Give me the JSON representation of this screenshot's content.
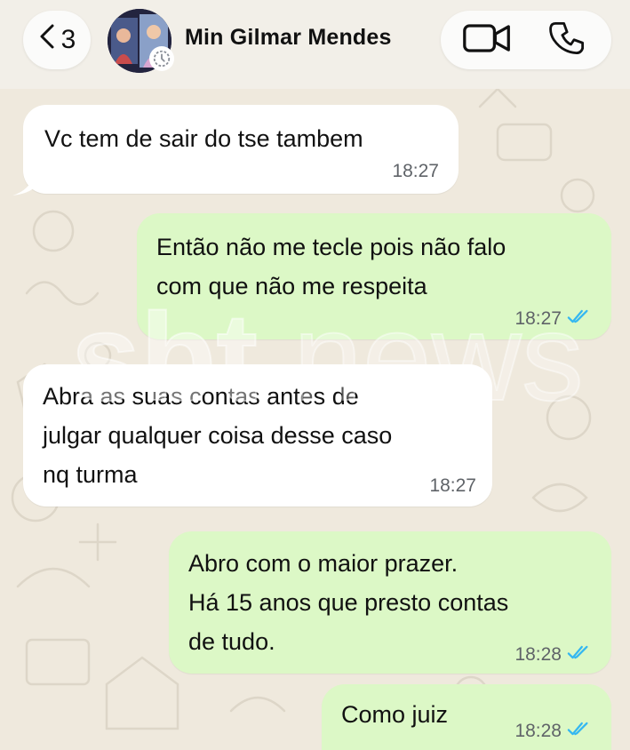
{
  "header": {
    "back_count": "3",
    "contact_name": "Min Gilmar Mendes"
  },
  "icons": {
    "back": "chevron-left-icon",
    "video": "video-camera-icon",
    "phone": "phone-icon",
    "status": "status-ring-icon",
    "read": "double-check-icon"
  },
  "colors": {
    "outgoing_bubble": "#dcf8c6",
    "incoming_bubble": "#ffffff",
    "read_check": "#34b7f1",
    "background": "#efe9dd"
  },
  "messages": [
    {
      "direction": "incoming",
      "text": "Vc tem de sair do tse tambem",
      "time": "18:27"
    },
    {
      "direction": "outgoing",
      "text": "Então não me tecle pois não falo\ncom que não me respeita",
      "time": "18:27",
      "read": true
    },
    {
      "direction": "incoming",
      "text": "Abra as suas contas antes de\njulgar qualquer coisa desse caso\nnq turma",
      "time": "18:27"
    },
    {
      "direction": "outgoing",
      "text": "Abro com o maior prazer.\nHá 15 anos que presto contas\nde tudo.",
      "time": "18:28",
      "read": true
    },
    {
      "direction": "outgoing",
      "text": "Como juiz",
      "time": "18:28",
      "read": true
    }
  ],
  "watermark": {
    "line1": "sbt",
    "line2": "news"
  }
}
